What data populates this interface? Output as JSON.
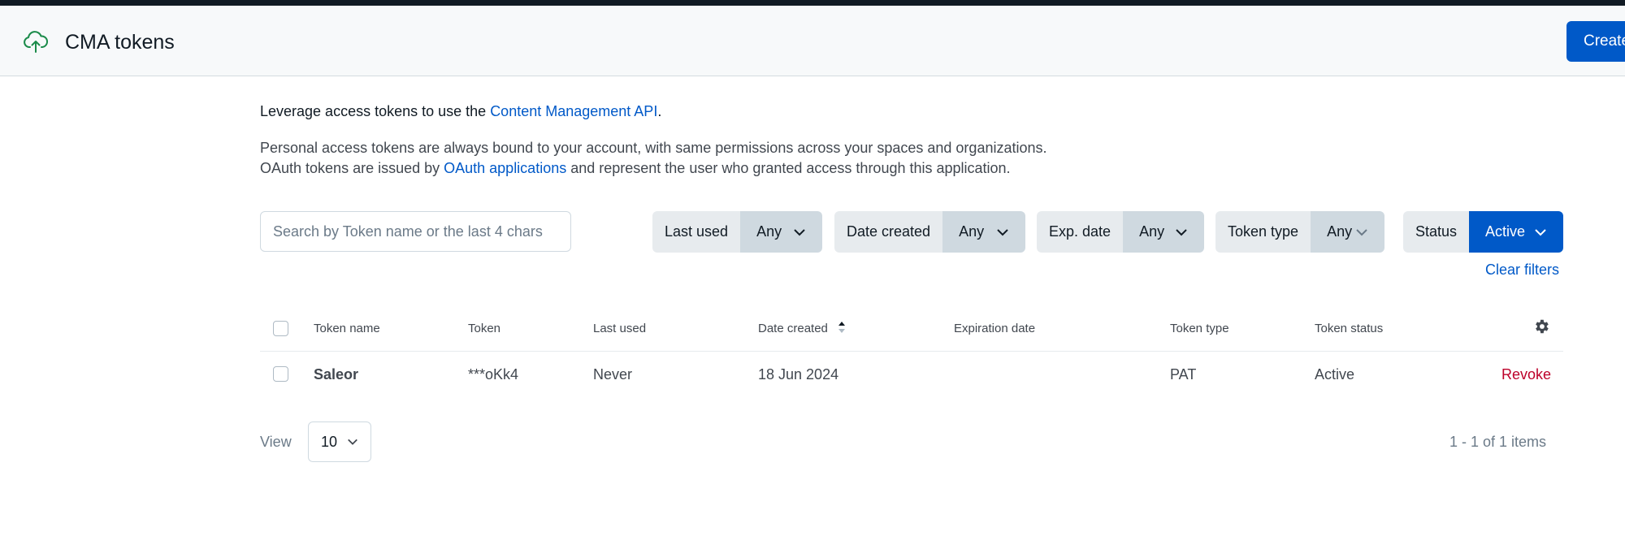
{
  "header": {
    "title": "CMA tokens",
    "create_label": "Create",
    "icon": "cloud-upload-icon",
    "accent": "#0059c8",
    "icon_color": "#1b8b4a"
  },
  "intro": {
    "line1_prefix": "Leverage access tokens to use the ",
    "line1_link": "Content Management API",
    "line1_suffix": ".",
    "line2": "Personal access tokens are always bound to your account, with same permissions across your spaces and organizations.",
    "line3_prefix": "OAuth tokens are issued by ",
    "line3_link": "OAuth applications",
    "line3_suffix": " and represent the user who granted access through this application."
  },
  "search": {
    "placeholder": "Search by Token name or the last 4 chars",
    "value": ""
  },
  "filters": [
    {
      "label": "Last used",
      "value": "Any"
    },
    {
      "label": "Date created",
      "value": "Any"
    },
    {
      "label": "Exp. date",
      "value": "Any"
    },
    {
      "label": "Token type",
      "value": "Any"
    },
    {
      "label": "Status",
      "value": "Active"
    }
  ],
  "clear_filters_label": "Clear filters",
  "table": {
    "columns": [
      "Token name",
      "Token",
      "Last used",
      "Date created",
      "Expiration date",
      "Token type",
      "Token status"
    ],
    "sort_column": "Date created",
    "rows": [
      {
        "name": "Saleor",
        "token": "***oKk4",
        "last_used": "Never",
        "date_created": "18 Jun 2024",
        "expiration_date": "",
        "type": "PAT",
        "status": "Active",
        "action": "Revoke"
      }
    ],
    "danger_color": "#bd002a"
  },
  "footer": {
    "view_label": "View",
    "page_size": "10",
    "range_text": "1 - 1 of 1 items"
  }
}
